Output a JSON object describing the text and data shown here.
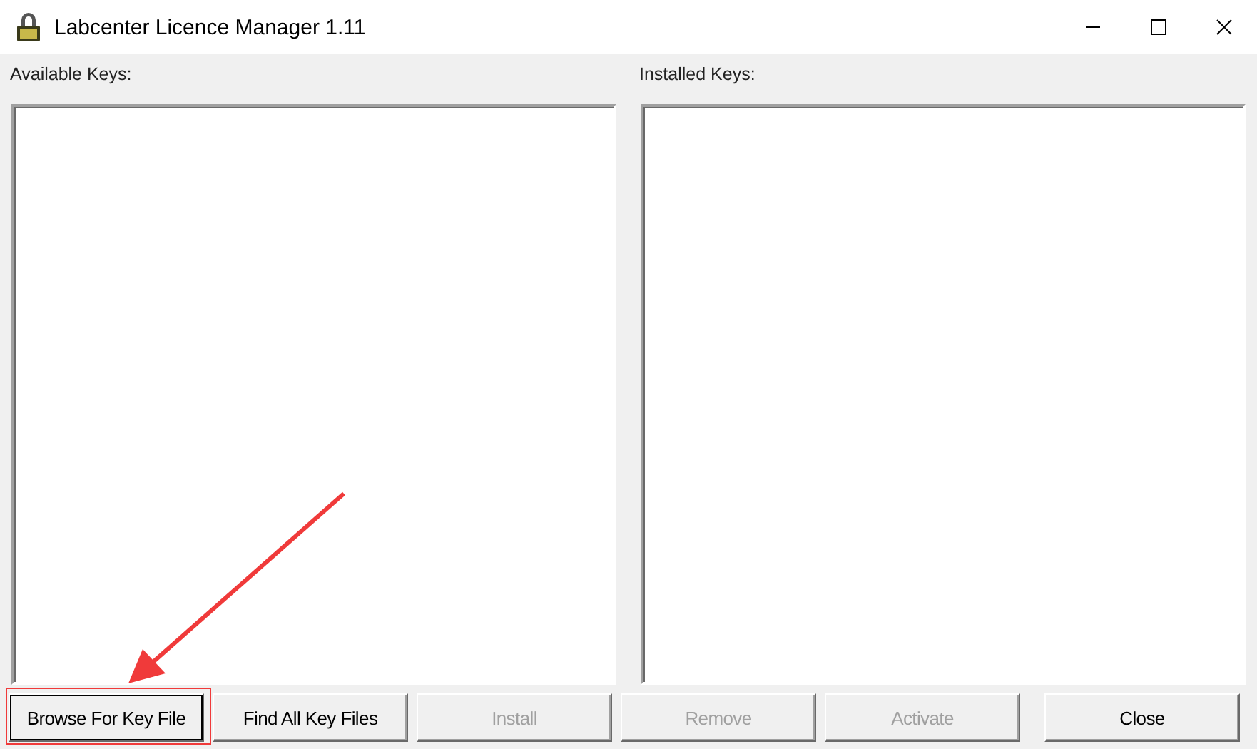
{
  "window": {
    "title": "Labcenter Licence Manager 1.11"
  },
  "panels": [
    {
      "label": "Available Keys:"
    },
    {
      "label": "Installed Keys:"
    }
  ],
  "buttons": [
    {
      "label": "Browse For Key File",
      "disabled": false,
      "focused": true
    },
    {
      "label": "Find All Key Files",
      "disabled": false,
      "focused": false
    },
    {
      "label": "Install",
      "disabled": true,
      "focused": false
    },
    {
      "label": "Remove",
      "disabled": true,
      "focused": false
    },
    {
      "label": "Activate",
      "disabled": true,
      "focused": false
    },
    {
      "label": "Close",
      "disabled": false,
      "focused": false
    }
  ]
}
